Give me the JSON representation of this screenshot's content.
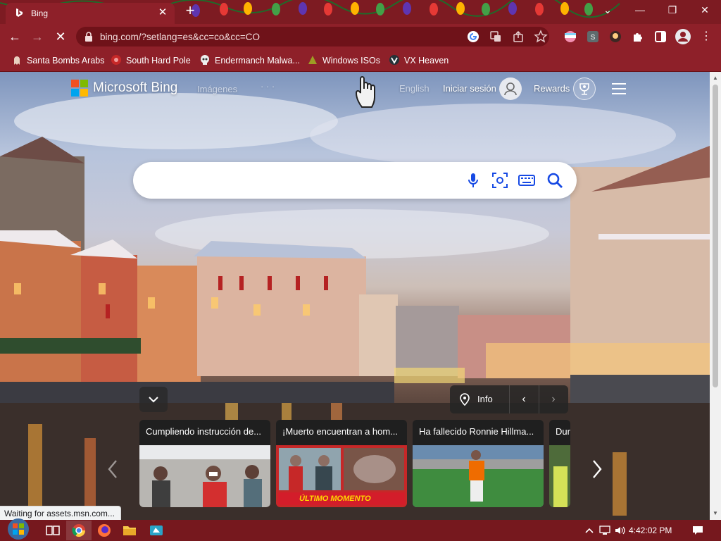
{
  "browser": {
    "tab_title": "Bing",
    "url": "bing.com/?setlang=es&cc=co&cc=CO",
    "bookmarks": [
      {
        "label": "Santa Bombs Arabs"
      },
      {
        "label": "South Hard Pole"
      },
      {
        "label": "Endermanch Malwa..."
      },
      {
        "label": "Windows ISOs"
      },
      {
        "label": "VX Heaven"
      }
    ],
    "profile_initial": "S",
    "status_text": "Waiting for assets.msn.com..."
  },
  "bing": {
    "logo_text": "Microsoft Bing",
    "nav_images": "Imágenes",
    "nav_more": "· · ·",
    "language": "English",
    "sign_in": "Iniciar sesión",
    "rewards": "Rewards",
    "search_placeholder": "",
    "info_label": "Info",
    "cards": [
      {
        "title": "Cumpliendo instrucción de..."
      },
      {
        "title": "¡Muerto encuentran a hom...",
        "badge": "ÚLTIMO MOMENTO"
      },
      {
        "title": "Ha fallecido Ronnie Hillma..."
      },
      {
        "title": "Dur"
      }
    ]
  },
  "taskbar": {
    "time": "4:42:02 PM"
  },
  "colors": {
    "titlebar": "#7d1b22",
    "toolbar": "#8e2029",
    "taskbar": "#76181e",
    "bing_blue": "#174ae4",
    "breaking_red": "#d31d2a",
    "breaking_text": "#ffd800"
  }
}
